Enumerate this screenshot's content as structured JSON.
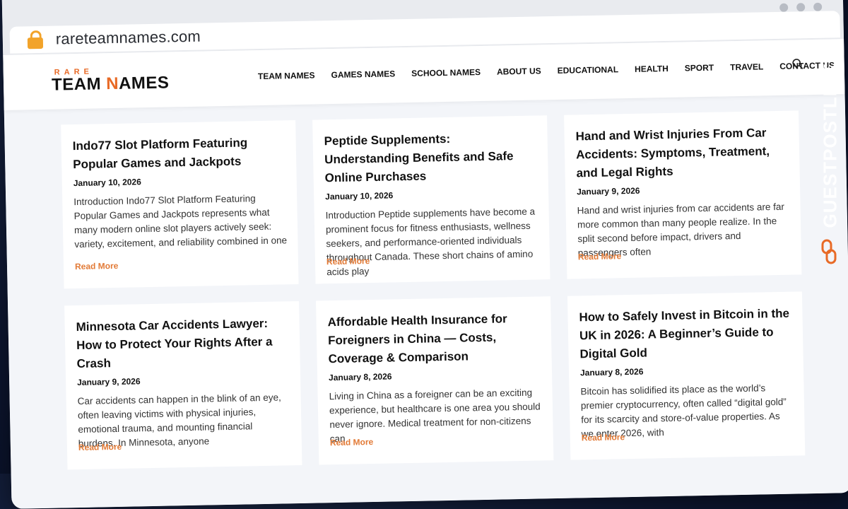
{
  "browser": {
    "url": "rareteamnames.com"
  },
  "site": {
    "logo": {
      "top": "RARE",
      "main_a": "TEAM ",
      "main_b": "N",
      "main_c": "AMES"
    },
    "nav": [
      "TEAM NAMES",
      "GAMES NAMES",
      "SCHOOL NAMES",
      "ABOUT US",
      "EDUCATIONAL",
      "HEALTH",
      "SPORT",
      "TRAVEL",
      "CONTACT US"
    ]
  },
  "posts": [
    {
      "title": "Indo77 Slot Platform Featuring Popular Games and Jackpots",
      "date": "January 10, 2026",
      "excerpt": "Introduction Indo77 Slot Platform Featuring Popular Games and Jackpots represents what many modern online slot players actively seek: variety, excitement, and reliability combined in one",
      "read_more": "Read More"
    },
    {
      "title": "Peptide Supplements: Understanding Benefits and Safe Online Purchases",
      "date": "January 10, 2026",
      "excerpt": "Introduction Peptide supplements have become a prominent focus for fitness enthusiasts, wellness seekers, and performance-oriented individuals throughout Canada. These short chains of amino acids play",
      "read_more": "Read More"
    },
    {
      "title": "Hand and Wrist Injuries From Car Accidents: Symptoms, Treatment, and Legal Rights",
      "date": "January 9, 2026",
      "excerpt": "Hand and wrist injuries from car accidents are far more common than many people realize. In the split second before impact, drivers and passengers often",
      "read_more": "Read More"
    },
    {
      "title": "Minnesota Car Accidents Lawyer: How to Protect Your Rights After a Crash",
      "date": "January 9, 2026",
      "excerpt": "Car accidents can happen in the blink of an eye, often leaving victims with physical injuries, emotional trauma, and mounting financial burdens. In Minnesota, anyone",
      "read_more": "Read More"
    },
    {
      "title": "Affordable Health Insurance for Foreigners in China — Costs, Coverage & Comparison",
      "date": "January 8, 2026",
      "excerpt": "Living in China as a foreigner can be an exciting experience, but healthcare is one area you should never ignore. Medical treatment for non-citizens can",
      "read_more": "Read More"
    },
    {
      "title": "How to Safely Invest in Bitcoin in the UK in 2026: A Beginner’s Guide to Digital Gold",
      "date": "January 8, 2026",
      "excerpt": "Bitcoin has solidified its place as the world’s premier cryptocurrency, often called “digital gold” for its scarcity and store-of-value properties. As we enter 2026, with",
      "read_more": "Read More"
    }
  ],
  "watermark": {
    "text": "GUESTPOSTLINKS"
  },
  "colors": {
    "accent": "#e86a26",
    "link": "#e27a36"
  }
}
